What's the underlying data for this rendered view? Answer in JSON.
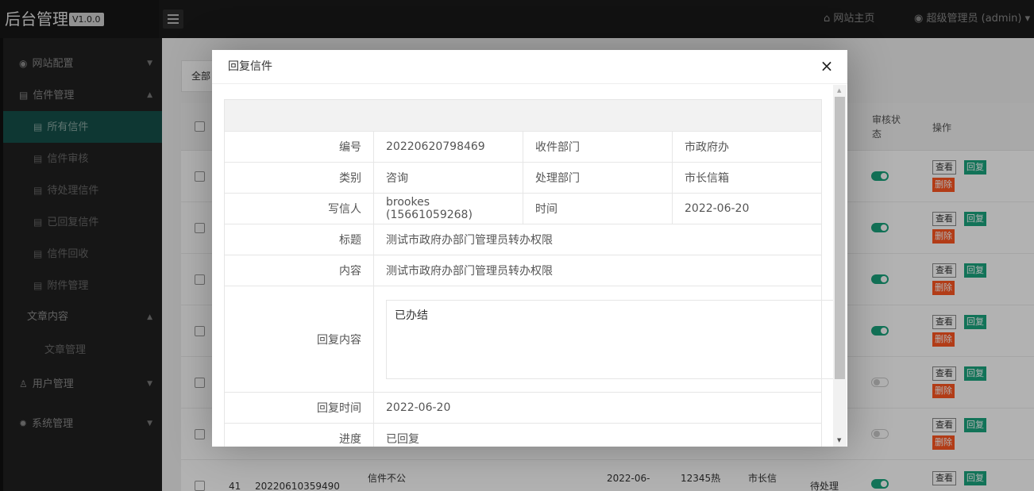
{
  "app": {
    "brand": "后台管理",
    "version": "V1.0.0",
    "home_link": "网站主页",
    "user_link": "超级管理员 (admin)"
  },
  "sidebar": {
    "groups": [
      {
        "label": "网站配置",
        "icon": "gear-circle-icon"
      },
      {
        "label": "信件管理",
        "icon": "document-icon"
      },
      {
        "label": "文章内容"
      },
      {
        "label": "用户管理",
        "icon": "user-icon"
      },
      {
        "label": "系统管理",
        "icon": "settings-icon"
      }
    ],
    "letter_items": [
      "所有信件",
      "信件审核",
      "待处理信件",
      "已回复信件",
      "信件回收",
      "附件管理"
    ],
    "article_items": [
      "文章管理"
    ]
  },
  "main": {
    "tab_label": "全部",
    "table_headers": {
      "review": "审核状态",
      "ops": "操作"
    },
    "row_buttons": {
      "view": "查看",
      "reply": "回复",
      "delete": "删除"
    },
    "last_row": {
      "id": "41",
      "number": "20220610359490",
      "title": "信件不公",
      "date": "2022-06-",
      "source": "12345热",
      "dept": "市长信",
      "status": "待处理"
    }
  },
  "modal": {
    "title": "回复信件",
    "fields": {
      "number_label": "编号",
      "number": "20220620798469",
      "recv_dept_label": "收件部门",
      "recv_dept": "市政府办",
      "category_label": "类别",
      "category": "咨询",
      "handle_dept_label": "处理部门",
      "handle_dept": "市长信箱",
      "writer_label": "写信人",
      "writer": "brookes (15661059268)",
      "time_label": "时间",
      "time": "2022-06-20",
      "title_label": "标题",
      "title": "测试市政府办部门管理员转办权限",
      "content_label": "内容",
      "content": "测试市政府办部门管理员转办权限",
      "reply_label": "回复内容",
      "reply": "已办结",
      "reply_time_label": "回复时间",
      "reply_time": "2022-06-20",
      "progress_label": "进度",
      "progress": "已回复"
    }
  },
  "colors": {
    "accent": "#1ba57e",
    "danger": "#ff5722",
    "sidebar_active": "#15504a",
    "header_bg": "#1b1b1b"
  }
}
